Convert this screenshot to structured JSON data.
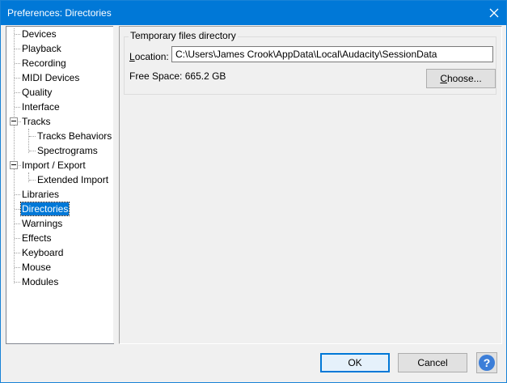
{
  "window": {
    "title": "Preferences: Directories"
  },
  "sidebar": {
    "items": [
      {
        "label": "Devices"
      },
      {
        "label": "Playback"
      },
      {
        "label": "Recording"
      },
      {
        "label": "MIDI Devices"
      },
      {
        "label": "Quality"
      },
      {
        "label": "Interface"
      },
      {
        "label": "Tracks",
        "expanded": true
      },
      {
        "label": "Tracks Behaviors"
      },
      {
        "label": "Spectrograms"
      },
      {
        "label": "Import / Export",
        "expanded": true
      },
      {
        "label": "Extended Import"
      },
      {
        "label": "Libraries"
      },
      {
        "label": "Directories",
        "selected": true
      },
      {
        "label": "Warnings"
      },
      {
        "label": "Effects"
      },
      {
        "label": "Keyboard"
      },
      {
        "label": "Mouse"
      },
      {
        "label": "Modules"
      }
    ]
  },
  "main": {
    "group_title": "Temporary files directory",
    "location_label_key": "L",
    "location_label_rest": "ocation:",
    "location_value": "C:\\Users\\James Crook\\AppData\\Local\\Audacity\\SessionData",
    "free_space_label": "Free Space:",
    "free_space_value": "665.2 GB",
    "choose_key": "C",
    "choose_rest": "hoose..."
  },
  "footer": {
    "ok_label": "OK",
    "cancel_label": "Cancel",
    "help_symbol": "?"
  },
  "colors": {
    "titlebar": "#0078d7",
    "selection": "#0078d7"
  }
}
